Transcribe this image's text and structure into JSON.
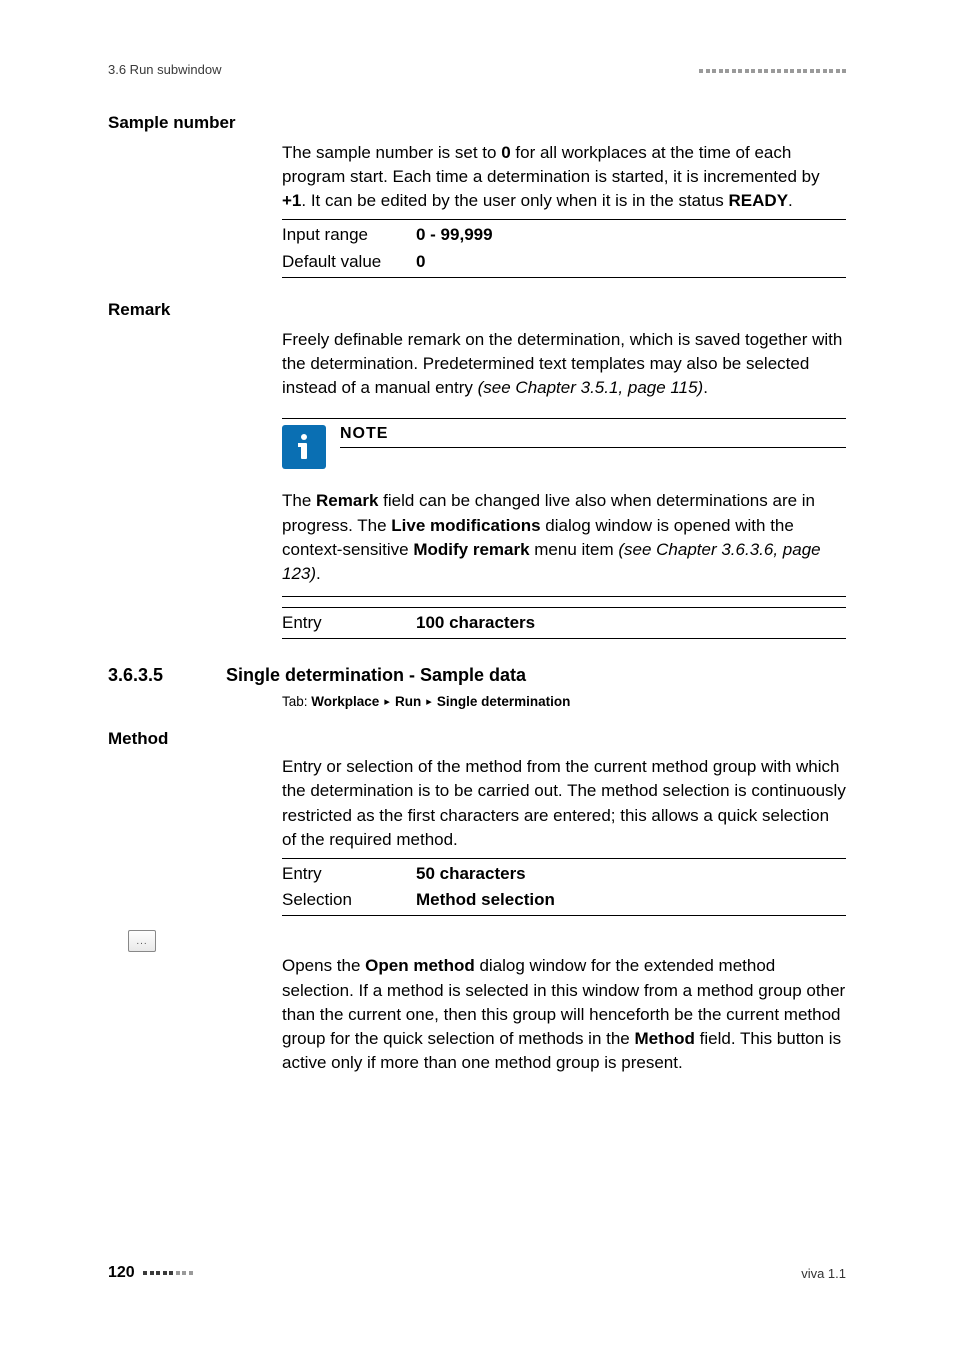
{
  "header": {
    "section_ref": "3.6 Run subwindow"
  },
  "sample_number": {
    "label": "Sample number",
    "para_1": "The sample number is set to ",
    "para_1_bold1": "0",
    "para_1_cont": " for all workplaces at the time of each program start. Each time a determination is started, it is incremented by ",
    "para_1_bold2": "+1",
    "para_1_cont2": ". It can be edited by the user only when it is in the status ",
    "para_1_bold3": "READY",
    "para_1_end": ".",
    "input_range_label": "Input range",
    "input_range_value": "0 - 99,999",
    "default_value_label": "Default value",
    "default_value_value": "0"
  },
  "remark": {
    "label": "Remark",
    "para": "Freely definable remark on the determination, which is saved together with the determination. Predetermined text templates may also be selected instead of a manual entry ",
    "para_ref": "(see Chapter 3.5.1, page 115)",
    "para_end": ".",
    "note_title": "NOTE",
    "note_body_1": "The ",
    "note_body_b1": "Remark",
    "note_body_2": " field can be changed live also when determinations are in progress. The ",
    "note_body_b2": "Live modifications",
    "note_body_3": " dialog window is opened with the context-sensitive ",
    "note_body_b3": "Modify remark",
    "note_body_4": " menu item ",
    "note_body_ref": "(see Chapter 3.6.3.6, page 123)",
    "note_body_end": ".",
    "entry_label": "Entry",
    "entry_value": "100 characters"
  },
  "section": {
    "number": "3.6.3.5",
    "title": "Single determination - Sample data",
    "tab_prefix": "Tab: ",
    "tab_path_1": "Workplace",
    "tab_path_2": "Run",
    "tab_path_3": "Single determination"
  },
  "method": {
    "label": "Method",
    "para": "Entry or selection of the method from the current method group with which the determination is to be carried out. The method selection is continuously restricted as the first characters are entered; this allows a quick selection of the required method.",
    "entry_label": "Entry",
    "entry_value": "50 characters",
    "selection_label": "Selection",
    "selection_value": "Method selection"
  },
  "open_method": {
    "icon_glyph": "...",
    "para_1": "Opens the ",
    "para_b1": "Open method",
    "para_2": " dialog window for the extended method selection. If a method is selected in this window from a method group other than the current one, then this group will henceforth be the current method group for the quick selection of methods in the ",
    "para_b2": "Method",
    "para_3": " field. This button is active only if more than one method group is present."
  },
  "footer": {
    "page_number": "120",
    "doc_version": "viva 1.1"
  }
}
